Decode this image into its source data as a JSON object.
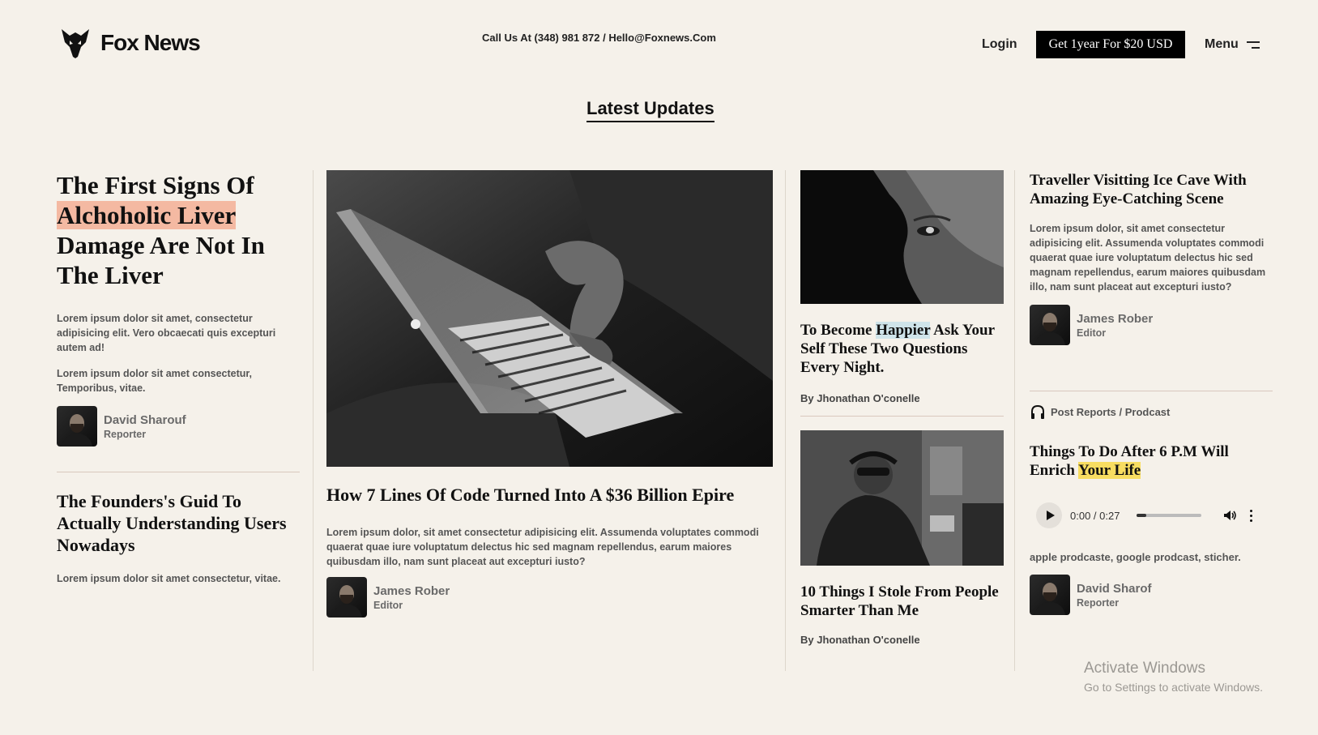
{
  "header": {
    "logo_text": "Fox News",
    "contact": "Call Us At (348) 981 872 / Hello@Foxnews.Com",
    "login_label": "Login",
    "subscribe_label": "Get 1year For $20 USD",
    "menu_label": "Menu"
  },
  "section_title": "Latest Updates",
  "col1": {
    "title_pre": "The First Signs Of",
    "title_highlight": "Alchoholic Liver",
    "title_post": "Damage Are Not In The Liver",
    "para1": "Lorem ipsum dolor sit amet, consectetur adipisicing elit. Vero obcaecati quis excepturi autem ad!",
    "para2": "Lorem ipsum dolor sit amet consectetur, Temporibus, vitae.",
    "author_name": "David Sharouf",
    "author_role": "Reporter",
    "title2": "The Founders's Guid To Actually Understanding Users Nowadays",
    "para3": "Lorem ipsum dolor sit amet consectetur, vitae."
  },
  "col2": {
    "title": "How 7 Lines Of Code Turned Into A $36 Billion Epire",
    "para": "Lorem ipsum dolor, sit amet consectetur adipisicing elit. Assumenda voluptates commodi quaerat quae iure voluptatum delectus hic sed magnam repellendus, earum maiores quibusdam illo, nam sunt placeat aut excepturi iusto?",
    "author_name": "James Rober",
    "author_role": "Editor"
  },
  "col3": {
    "title1_pre": "To Become",
    "title1_highlight": "Happier",
    "title1_post": "Ask Your Self These Two Questions Every Night.",
    "byline1": "By Jhonathan O'conelle",
    "title2": "10 Things I Stole From People Smarter Than Me",
    "byline2": "By Jhonathan O'conelle"
  },
  "col4": {
    "title1": "Traveller Visitting Ice Cave With Amazing Eye-Catching Scene",
    "para": "Lorem ipsum dolor, sit amet consectetur adipisicing elit. Assumenda voluptates commodi quaerat quae iure voluptatum delectus hic sed magnam repellendus, earum maiores quibusdam illo, nam sunt placeat aut excepturi iusto?",
    "author1_name": "James Rober",
    "author1_role": "Editor",
    "podcast_tag": "Post Reports / Prodcast",
    "title2_pre": "Things To Do After 6 P.M Will Enrich",
    "title2_highlight": "Your Life",
    "audio_time": "0:00 / 0:27",
    "audio_progress": 0.15,
    "platforms": "apple prodcaste, google prodcast, sticher.",
    "author2_name": "David Sharof",
    "author2_role": "Reporter"
  },
  "watermark": {
    "line1": "Activate Windows",
    "line2": "Go to Settings to activate Windows."
  },
  "colors": {
    "background": "#f5f1ea",
    "highlight_peach": "#f4b9a2",
    "highlight_blue": "#cfe4ea",
    "highlight_yellow": "#f8dd61"
  }
}
